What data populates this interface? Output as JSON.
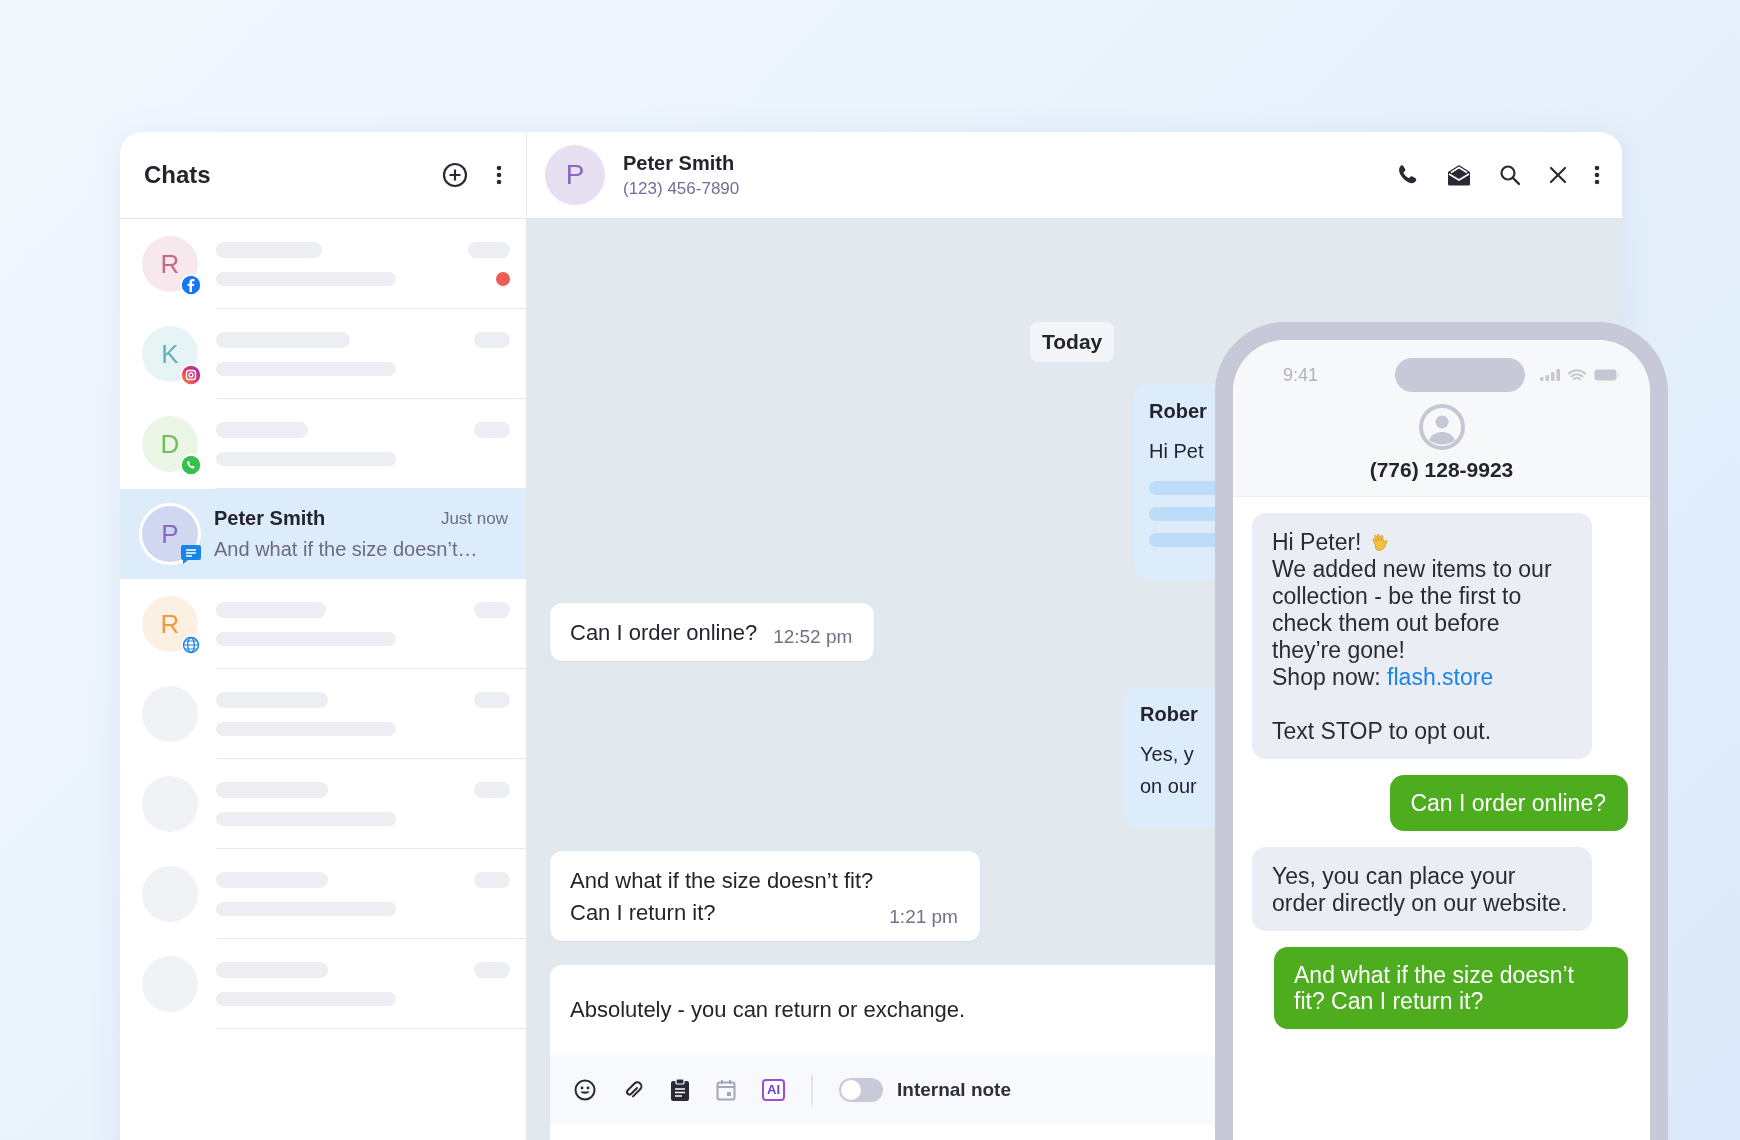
{
  "sidebar": {
    "title": "Chats",
    "chats": [
      {
        "kind": "skeleton",
        "avatar": "R",
        "color": "#c9668a",
        "badge": {
          "kind": "facebook"
        },
        "unread": true,
        "selected": false
      },
      {
        "kind": "skeleton",
        "avatar": "K",
        "color": "#5fb3bb",
        "badge": {
          "kind": "instagram"
        },
        "unread": false,
        "selected": false
      },
      {
        "kind": "skeleton",
        "avatar": "D",
        "color": "#72bb55",
        "badge": {
          "kind": "whatsapp"
        },
        "unread": false,
        "selected": false
      },
      {
        "kind": "contact",
        "avatar": "P",
        "color": "#8a68bf",
        "badge": {
          "kind": "sms"
        },
        "unread": false,
        "selected": true,
        "name": "Peter Smith",
        "time": "Just now",
        "preview": "And what if the size doesn’t…"
      },
      {
        "kind": "skeleton",
        "avatar": "R",
        "color": "#ee9a3e",
        "badge": {
          "kind": "web"
        },
        "unread": false,
        "selected": false
      },
      {
        "kind": "empty",
        "unread": false,
        "selected": false
      },
      {
        "kind": "empty",
        "unread": false,
        "selected": false
      },
      {
        "kind": "empty",
        "unread": false,
        "selected": false
      },
      {
        "kind": "empty",
        "unread": false,
        "selected": false
      }
    ]
  },
  "header": {
    "avatar": "P",
    "name": "Peter Smith",
    "phone": "(123) 456-7890"
  },
  "chat": {
    "date": "Today",
    "messages": [
      {
        "kind": "agent",
        "sender": "Rober",
        "lines": [
          "Hi Pet"
        ],
        "placeholder_lines": true
      },
      {
        "kind": "customer",
        "lines": [
          "Can I order online?"
        ],
        "time": "12:52 pm"
      },
      {
        "kind": "agent",
        "sender": "Rober",
        "lines": [
          "Yes, y",
          "on our"
        ],
        "placeholder_lines": false
      },
      {
        "kind": "customer",
        "lines": [
          "And what if the size doesn’t fit?",
          "Can I return it?"
        ],
        "time": "1:21 pm"
      }
    ],
    "composer": {
      "value": "Absolutely - you can return or exchange.",
      "ai_label": "AI",
      "internal_note": {
        "label": "Internal note",
        "on": false
      }
    }
  },
  "phone": {
    "time": "9:41",
    "contact": "(776) 128-9923",
    "messages": [
      {
        "kind": "incoming",
        "greeting": "Hi Peter!",
        "text": "We added new items to our collection - be the first to check them out before they’re gone!",
        "link_prefix": "Shop now:",
        "link": "flash.store",
        "footer": "Text STOP to opt out."
      },
      {
        "kind": "outgoing",
        "text": "Can I order online?"
      },
      {
        "kind": "incoming",
        "text": "Yes, you can place your order directly on our website."
      },
      {
        "kind": "outgoing",
        "text": "And what if the size doesn’t fit? Can I return it?"
      }
    ]
  }
}
